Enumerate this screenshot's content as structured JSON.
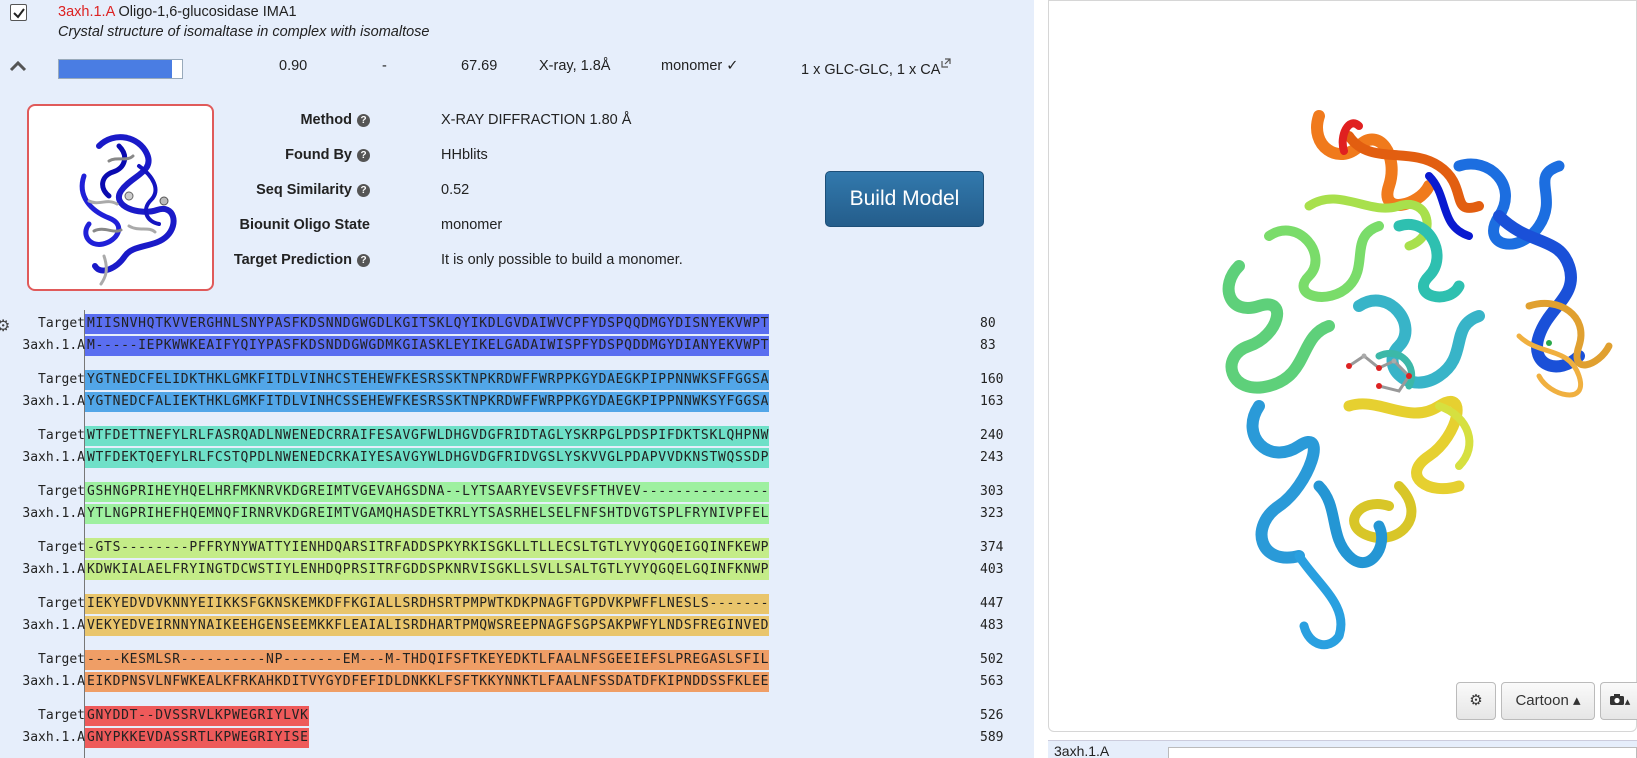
{
  "template": {
    "pdb_id": "3axh.1.A",
    "name": "Oligo-1,6-glucosidase IMA1",
    "description": "Crystal structure of isomaltase in complex with isomaltose",
    "coverage": 0.92,
    "gmqe": "0.90",
    "qmean": "-",
    "identity": "67.69",
    "method_short": "X-ray, 1.8Å",
    "oligo": "monomer ✓",
    "ligands": "1 x GLC-GLC, 1 x CA"
  },
  "details": {
    "method_label": "Method",
    "method_value": "X-RAY DIFFRACTION 1.80 Å",
    "found_by_label": "Found By",
    "found_by_value": "HHblits",
    "seq_sim_label": "Seq Similarity",
    "seq_sim_value": "0.52",
    "biounit_label": "Biounit Oligo State",
    "biounit_value": "monomer",
    "target_pred_label": "Target Prediction",
    "target_pred_value": "It is only possible to build a monomer.",
    "help_icon": "?"
  },
  "build_button": "Build Model",
  "alignment": {
    "target_label": "Target",
    "template_label": "3axh.1.A",
    "blocks": [
      {
        "t": "MIISNVHQTKVVERGHNLSNYPASFKDSNNDGWGDLKGITSKLQYIKDLGVDAIWVCPFYDSPQQDMGYDISNYEKVWPT",
        "tn": "80",
        "s": "M-----IEPKWWKEAIFYQIYPASFKDSNDDGWGDMKGIASKLEYIKELGADAIWISPFYDSPQDDMGYDIANYEKVWPT",
        "sn": "83",
        "c": "#5a6ef0"
      },
      {
        "t": "YGTNEDCFELIDKTHKLGMKFITDLVINHCSTEHEWFKESRSSKTNPKRDWFFWRPPKGYDAEGKPIPPNNWKSFFGGSA",
        "tn": "160",
        "s": "YGTNEDCFALIEKTHKLGMKFITDLVINHCSSEHEWFKESRSSKTNPKRDWFFWRPPKGYDAEGKPIPPNNWKSYFGGSA",
        "sn": "163",
        "c": "#52a6e8"
      },
      {
        "t": "WTFDETTNEFYLRLFASRQADLNWENEDCRRAIFESAVGFWLDHGVDGFRIDTAGLYSKRPGLPDSPIFDKTSKLQHPNW",
        "tn": "240",
        "s": "WTFDEKTQEFYLRLFCSTQPDLNWENEDCRKAIYESAVGYWLDHGVDGFRIDVGSLYSKVVGLPDAPVVDKNSTWQSSDP",
        "sn": "243",
        "c": "#6fe0c8"
      },
      {
        "t": "GSHNGPRIHEYHQELHRFMKNRVKDGREIMTVGEVAHGSDNA--LYTSAARYEVSEVFSFTHVEV---------------",
        "tn": "303",
        "s": "YTLNGPRIHEFHQEMNQFIRNRVKDGREIMTVGAMQHASDETKRLYTSASRHELSELFNFSHTDVGTSPLFRYNIVPFEL",
        "sn": "323",
        "c": "#9ef0a0"
      },
      {
        "t": "-GTS--------PFFRYNYWATTYIENHDQARSITRFADDSPKYRKISGKLLTLLECSLTGTLYVYQGQEIGQINFKEWP",
        "tn": "374",
        "s": "KDWKIALAELFRYINGTDCWSTIYLENHDQPRSITRFGDDSPKNRVISGKLLSVLLSALTGTLYVYQGQELGQINFKNWP",
        "sn": "403",
        "c": "#c4ec88"
      },
      {
        "t": "IEKYEDVDVKNNYEIIKKSFGKNSKEMKDFFKGIALLSRDHSRTPMPWTKDKPNAGFTGPDVKPWFFLNESLS-------",
        "tn": "447",
        "s": "VEKYEDVEIRNNYNAIKEEHGENSEEMKKFLEAIALISRDHARTPMQWSREEPNAGFSGPSAKPWFYLNDSFREGINVED",
        "sn": "483",
        "c": "#e9c56c"
      },
      {
        "t": "----KESMLSR----------NP-------EM---M-THDQIFSFTKEYEDKTLFAALNFSGEEIEFSLPREGASLSFIL",
        "tn": "502",
        "s": "EIKDPNSVLNFWKEALKFRKAHKDITVYGYDFEFIDLDNKKLFSFTKKYNNKTLFAALNFSSDATDFKIPNDDSSFKLEE",
        "sn": "563",
        "c": "#ef9e66"
      },
      {
        "t": "GNYDDT--DVSSRVLKPWEGRIYLVK",
        "tn": "526",
        "s": "GNYPKKEVDASSRTLKPWEGRIYISE",
        "sn": "589",
        "c": "#ee5a5a"
      }
    ]
  },
  "viewer": {
    "style_label": "Cartoon",
    "settings_icon": "gear-icon",
    "camera_icon": "camera-icon",
    "bottom_label": "3axh.1.A"
  },
  "colors": {
    "panel_bg": "#e6eefb",
    "build_button": "#2a6a9c",
    "pdb_id": "#d22222",
    "coverage_fill": "#4a7de3"
  }
}
